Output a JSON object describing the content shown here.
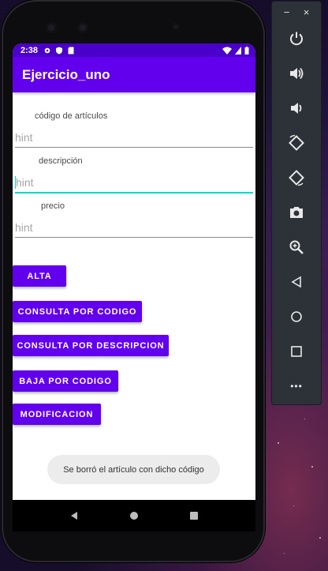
{
  "status_bar": {
    "time": "2:38"
  },
  "app": {
    "title": "Ejercicio_uno"
  },
  "form": {
    "fields": [
      {
        "label": "código de artículos",
        "hint": "hint"
      },
      {
        "label": "descripción",
        "hint": "hint"
      },
      {
        "label": "precio",
        "hint": "hint"
      }
    ]
  },
  "buttons": {
    "alta": "ALTA",
    "consulta_codigo": "CONSULTA POR CODIGO",
    "consulta_descripcion": "CONSULTA POR DESCRIPCION",
    "baja_codigo": "BAJA POR CODIGO",
    "modificacion": "MODIFICACION"
  },
  "toast": {
    "message": "Se borró el artículo con dicho código"
  },
  "emulator_toolbar": {
    "minimize_label": "−",
    "close_label": "×",
    "more_label": "•••",
    "items": [
      "power-icon",
      "volume-up-icon",
      "volume-down-icon",
      "rotate-left-icon",
      "rotate-right-icon",
      "camera-icon",
      "zoom-icon",
      "back-icon",
      "home-icon",
      "overview-icon",
      "more-icon"
    ]
  },
  "colors": {
    "primary": "#6200ee",
    "primary_dark": "#4b00c9",
    "accent": "#03dac5"
  }
}
